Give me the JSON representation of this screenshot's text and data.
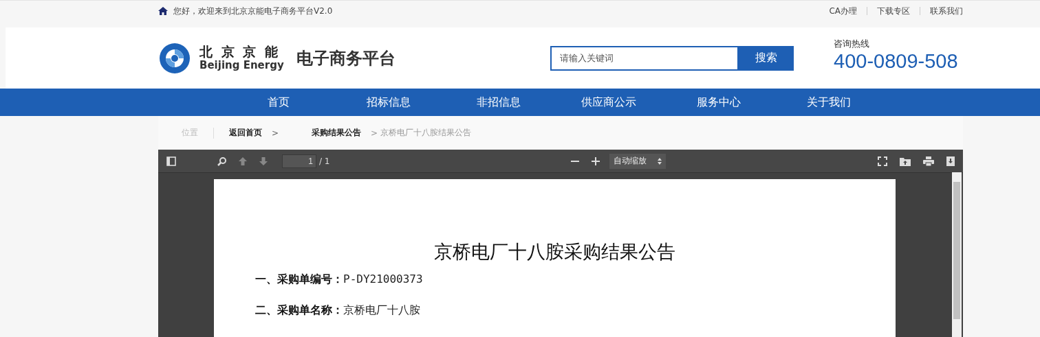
{
  "top_bar": {
    "welcome": "您好，欢迎来到北京京能电子商务平台V2.0",
    "links": [
      "CA办理",
      "下载专区",
      "联系我们"
    ]
  },
  "header": {
    "logo_cn": "北 京 京 能",
    "logo_en": "Beijing Energy",
    "platform_name": "电子商务平台",
    "search": {
      "placeholder": "请输入关键词",
      "button": "搜索"
    },
    "hotline_label": "咨询热线",
    "hotline": "400-0809-508"
  },
  "nav": [
    {
      "label": "首页"
    },
    {
      "label": "招标信息"
    },
    {
      "label": "非招信息"
    },
    {
      "label": "供应商公示"
    },
    {
      "label": "服务中心"
    },
    {
      "label": "关于我们"
    }
  ],
  "breadcrumb": {
    "label": "位置",
    "items": [
      {
        "label": "返回首页",
        "current": false,
        "separator": ">"
      },
      {
        "label": "采购结果公告",
        "current": false,
        "separator": ">"
      },
      {
        "label": "京桥电厂十八胺结果公告",
        "current": true
      }
    ]
  },
  "pdf_viewer": {
    "page_input": "1",
    "page_count": "/ 1",
    "zoom": "自动缩放",
    "document": {
      "title": "京桥电厂十八胺采购结果公告",
      "fields": [
        {
          "label": "一、采购单编号：",
          "value": "P-DY21000373"
        },
        {
          "label": "二、采购单名称：",
          "value": "京桥电厂十八胺"
        }
      ]
    }
  }
}
